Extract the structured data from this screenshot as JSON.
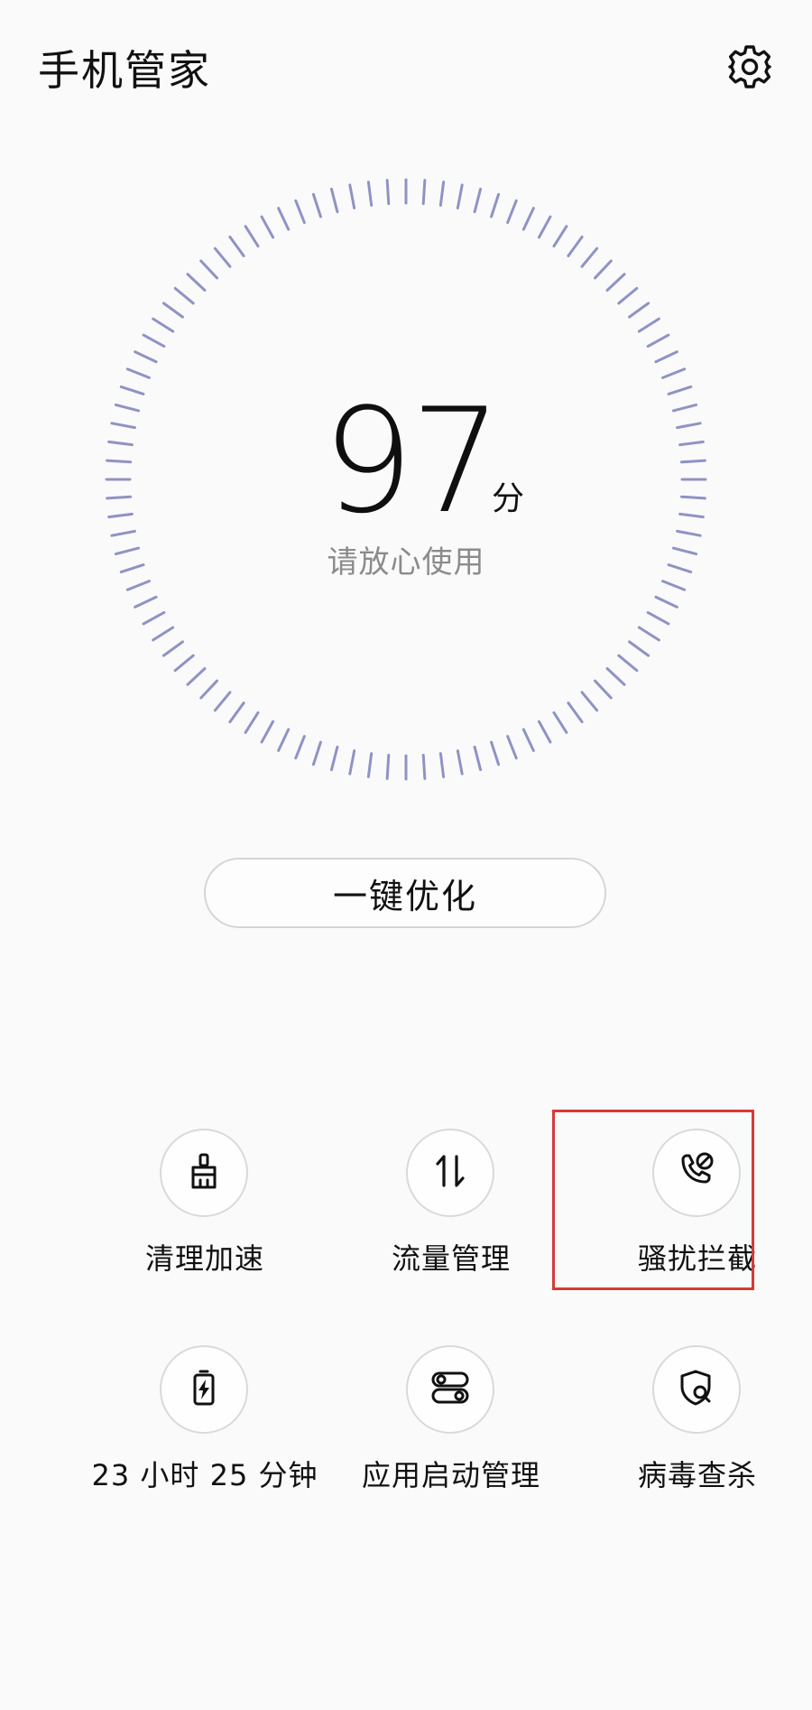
{
  "header": {
    "title": "手机管家",
    "settings_icon": "gear-icon"
  },
  "score": {
    "value": "97",
    "unit": "分",
    "status": "请放心使用"
  },
  "optimize_button": {
    "label": "一键优化"
  },
  "tools": [
    {
      "label": "清理加速",
      "icon": "broom-icon"
    },
    {
      "label": "流量管理",
      "icon": "data-traffic-icon"
    },
    {
      "label": "骚扰拦截",
      "icon": "call-block-icon"
    },
    {
      "label": "23 小时 25 分钟",
      "icon": "battery-icon"
    },
    {
      "label": "应用启动管理",
      "icon": "app-launch-icon"
    },
    {
      "label": "病毒查杀",
      "icon": "virus-scan-icon"
    }
  ],
  "colors": {
    "dial_tick": "#8f93c4",
    "highlight_border": "#d63a3a",
    "status_text": "#8b8b8b"
  }
}
